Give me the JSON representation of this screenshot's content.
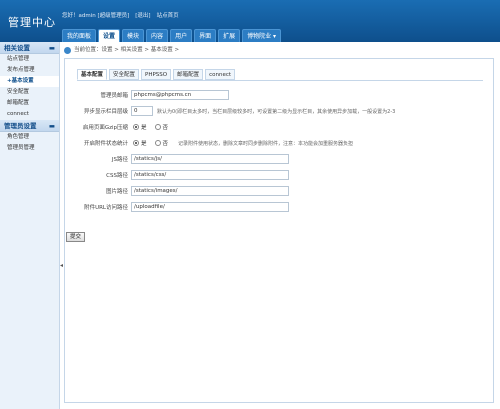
{
  "header": {
    "app_title": "管理中心",
    "user_info": [
      "您好！admin [超级管理员]",
      "[退出]",
      "站点首页"
    ]
  },
  "nav": {
    "tabs": [
      {
        "label": "我的面板"
      },
      {
        "label": "设置"
      },
      {
        "label": "模块"
      },
      {
        "label": "内容"
      },
      {
        "label": "用户"
      },
      {
        "label": "界面"
      },
      {
        "label": "扩展"
      },
      {
        "label": "博物院业 ▾"
      }
    ],
    "active": "设置"
  },
  "sidebar": {
    "sections": [
      {
        "title": "相关设置",
        "items": [
          "站点管理",
          "发布点管理",
          "+基本设置",
          "安全配置",
          "邮箱配置",
          "connect"
        ]
      },
      {
        "title": "管理员设置",
        "items": [
          "角色管理",
          "管理员管理"
        ]
      }
    ],
    "active_item": "+基本设置",
    "collapse_glyph": "◂"
  },
  "breadcrumb": "当前位置：设置 > 相关设置 > 基本设置 >",
  "settings_tabs": [
    "基本配置",
    "安全配置",
    "PHPSSO",
    "邮箱配置",
    "connect"
  ],
  "form": {
    "admin_email": {
      "label": "管理员邮箱",
      "value": "phpcms@phpcms.cn"
    },
    "async_category": {
      "label": "异步显示栏目层级",
      "value": "0",
      "hint": "默认为0(即栏目太多时，当栏目层级较多时，可设置第二级为显示栏目，其余使用异步加载，一般设置为2-3"
    },
    "gzip": {
      "label": "启用页面Gzip压缩",
      "yes": "是",
      "no": "否"
    },
    "attachment_stats": {
      "label": "开启附件状态统计",
      "yes": "是",
      "no": "否",
      "hint": "记录附件使用状态，删除文章时同步删除附件，注意：本功能会加重服务器负担"
    },
    "js_path": {
      "label": "JS路径",
      "value": "/statics/js/"
    },
    "css_path": {
      "label": "CSS路径",
      "value": "/statics/css/"
    },
    "img_path": {
      "label": "图片路径",
      "value": "/statics/images/"
    },
    "upload_url": {
      "label": "附件URL访问路径",
      "value": "/uploadfile/"
    }
  },
  "submit_label": "提交"
}
